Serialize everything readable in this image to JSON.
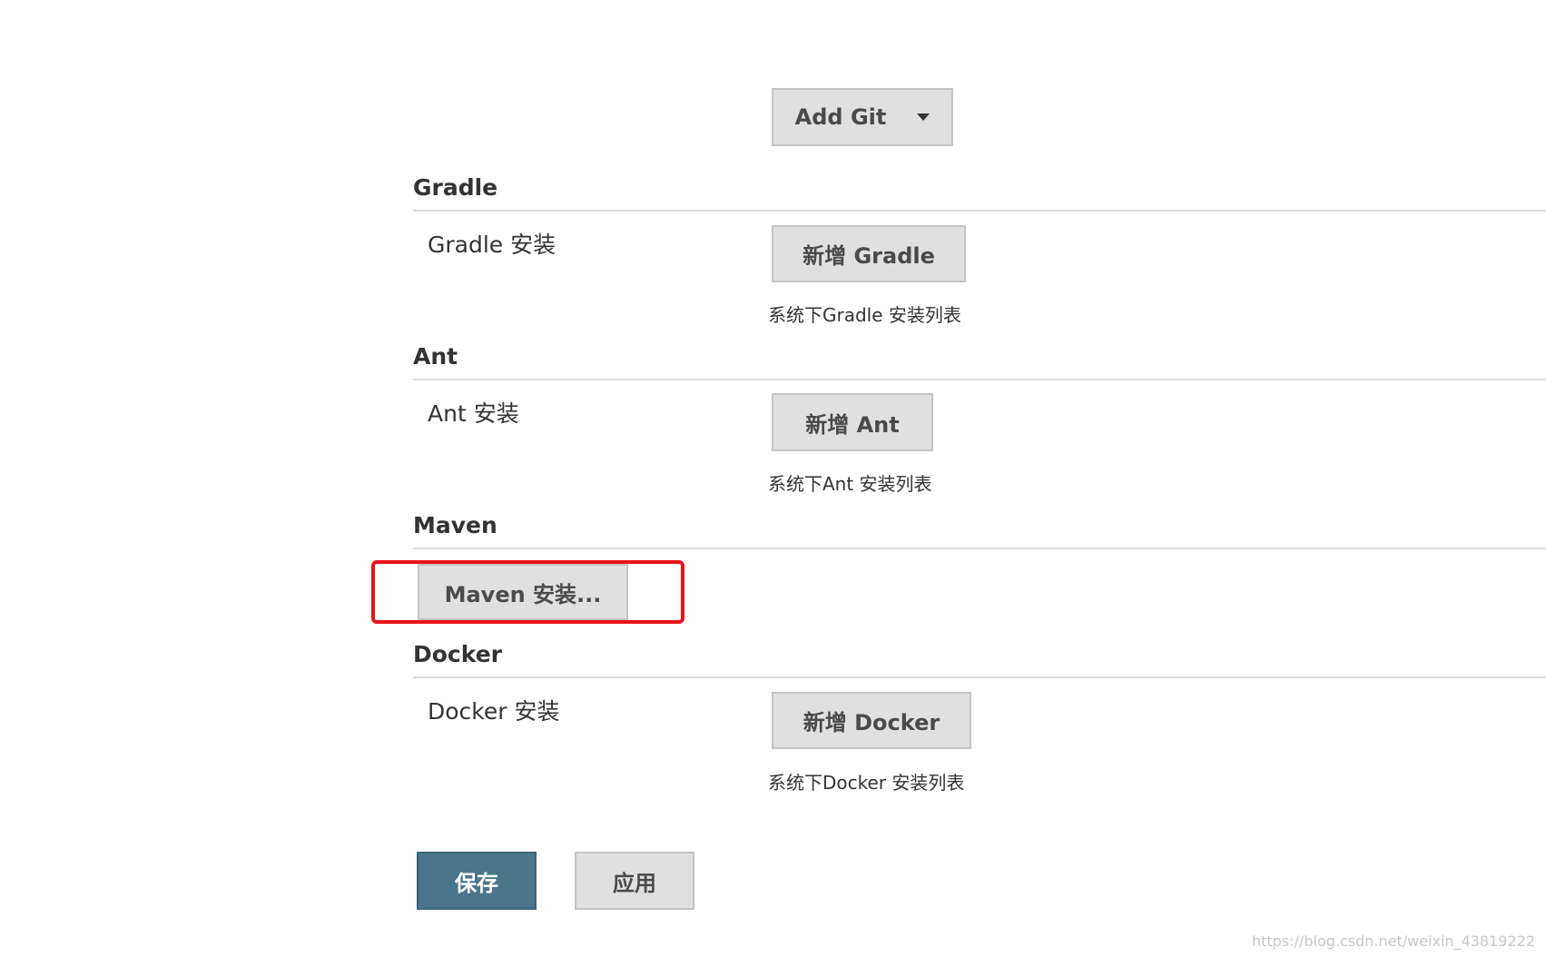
{
  "git": {
    "add_button_label": "Add Git"
  },
  "sections": {
    "gradle": {
      "title": "Gradle",
      "row_label": "Gradle 安装",
      "add_button_label": "新增 Gradle",
      "help_text": "系统下Gradle 安装列表"
    },
    "ant": {
      "title": "Ant",
      "row_label": "Ant 安装",
      "add_button_label": "新增 Ant",
      "help_text": "系统下Ant 安装列表"
    },
    "maven": {
      "title": "Maven",
      "install_button_label": "Maven 安装..."
    },
    "docker": {
      "title": "Docker",
      "row_label": "Docker 安装",
      "add_button_label": "新增 Docker",
      "help_text": "系统下Docker 安装列表"
    }
  },
  "footer": {
    "save_label": "保存",
    "apply_label": "应用"
  },
  "watermark": "https://blog.csdn.net/weixin_43819222",
  "colors": {
    "primary": "#4b758b",
    "highlight": "#e8141b",
    "button_bg": "#e0e0e0"
  }
}
